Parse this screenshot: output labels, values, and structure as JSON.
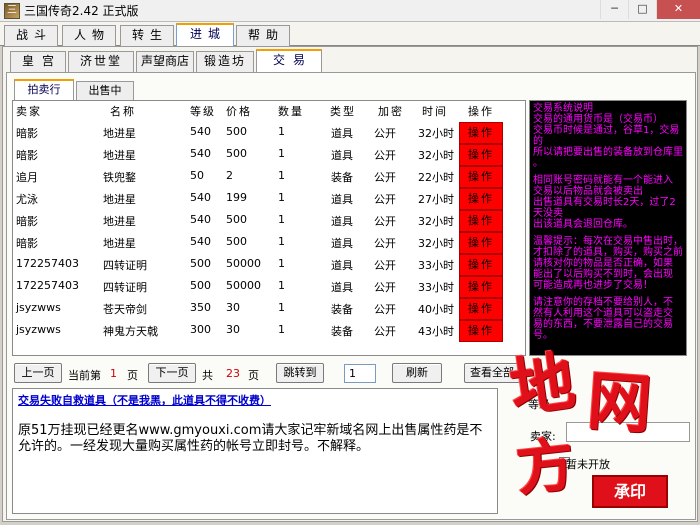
{
  "window": {
    "title": "三国传奇2.42 正式版",
    "minimize": "─",
    "maximize": "□",
    "close": "✕"
  },
  "main_tabs": [
    "战斗",
    "人物",
    "转生",
    "进城",
    "帮助"
  ],
  "sub_tabs": [
    "皇宫",
    "济世堂",
    "声望商店",
    "锻造坊",
    "交易"
  ],
  "trade_tabs": [
    "拍卖行",
    "出售中"
  ],
  "table": {
    "headers": [
      "卖家",
      "名称",
      "等级",
      "价格",
      "数量",
      "类型",
      "加密",
      "时间",
      "操作"
    ],
    "rows": [
      {
        "seller": "暗影",
        "name": "地进星",
        "level": "540",
        "price": "500",
        "qty": "1",
        "type": "道具",
        "enc": "公开",
        "time": "32小时",
        "op": "操作"
      },
      {
        "seller": "暗影",
        "name": "地进星",
        "level": "540",
        "price": "500",
        "qty": "1",
        "type": "道具",
        "enc": "公开",
        "time": "32小时",
        "op": "操作"
      },
      {
        "seller": "追月",
        "name": "铁兜鍪",
        "level": "50",
        "price": "2",
        "qty": "1",
        "type": "装备",
        "enc": "公开",
        "time": "22小时",
        "op": "操作"
      },
      {
        "seller": "尤泳",
        "name": "地进星",
        "level": "540",
        "price": "199",
        "qty": "1",
        "type": "道具",
        "enc": "公开",
        "time": "27小时",
        "op": "操作"
      },
      {
        "seller": "暗影",
        "name": "地进星",
        "level": "540",
        "price": "500",
        "qty": "1",
        "type": "道具",
        "enc": "公开",
        "time": "32小时",
        "op": "操作"
      },
      {
        "seller": "暗影",
        "name": "地进星",
        "level": "540",
        "price": "500",
        "qty": "1",
        "type": "道具",
        "enc": "公开",
        "time": "32小时",
        "op": "操作"
      },
      {
        "seller": "172257403",
        "name": "四转证明",
        "level": "500",
        "price": "50000",
        "qty": "1",
        "type": "道具",
        "enc": "公开",
        "time": "33小时",
        "op": "操作"
      },
      {
        "seller": "172257403",
        "name": "四转证明",
        "level": "500",
        "price": "50000",
        "qty": "1",
        "type": "道具",
        "enc": "公开",
        "time": "33小时",
        "op": "操作"
      },
      {
        "seller": "jsyzwws",
        "name": "苍天帝剑",
        "level": "350",
        "price": "30",
        "qty": "1",
        "type": "装备",
        "enc": "公开",
        "time": "40小时",
        "op": "操作"
      },
      {
        "seller": "jsyzwws",
        "name": "神鬼方天戟",
        "level": "300",
        "price": "30",
        "qty": "1",
        "type": "装备",
        "enc": "公开",
        "time": "43小时",
        "op": "操作"
      }
    ]
  },
  "help": {
    "p1": "交易系统说明\n交易的通用货币是（交易币）\n交易币时候是通过，谷草1，交易的\n所以请把要出售的装备放到仓库里\n。",
    "p2": "相同账号密码就能有一个能进入\n交易以后物品就会被卖出\n出售道具有交易时长2天，过了2天没卖\n出该道具会退回仓库。",
    "p3": "温馨提示：每次在交易中售出时，\n才扣除了的道具，购买，购买之前\n请核对你的物品是否正确，如果\n能出了以后购买不到时，会出现\n可能造成再也进步了交易！",
    "p4": "请注意你的存档不要给别人，不\n然有人利用这个道具可以盗走交\n易的东西，不要泄露自己的交易号。"
  },
  "pager": {
    "prev": "上一页",
    "current_label": "当前第",
    "current": "1",
    "page_unit": "页",
    "next": "下一页",
    "total_label": "共",
    "total": "23",
    "total_unit": "页",
    "goto": "跳转到",
    "goto_value": "1",
    "refresh": "刷新",
    "view_all": "查看全部"
  },
  "notice": {
    "link": "交易失败自救道具（不是我黑，此道具不得不收费）",
    "text": "原51万挂现已经更名www.gmyouxi.com请大家记牢新域名网上出售属性药是不允许的。一经发现大量购买属性药的帐号立即封号。不解释。"
  },
  "right_form": {
    "level_label": "等级",
    "price_label": "卖家:",
    "checkbox_label": "暂未开放",
    "stamp_text": "承印"
  },
  "watermark": {
    "chars": [
      "地",
      "网",
      "方"
    ]
  }
}
